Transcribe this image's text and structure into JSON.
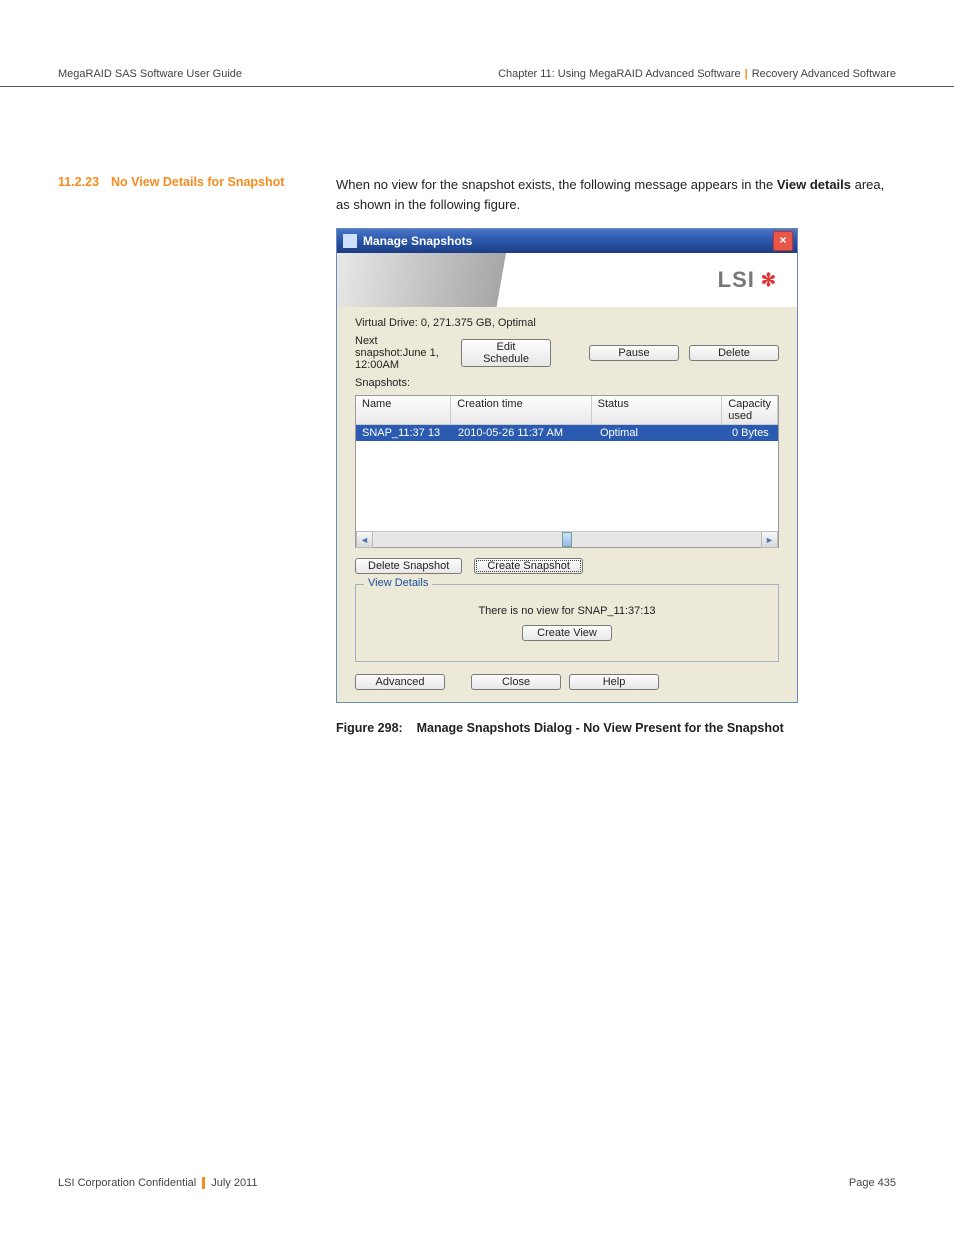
{
  "header": {
    "doc_title": "MegaRAID SAS Software User Guide",
    "chapter": "Chapter 11: Using MegaRAID Advanced Software",
    "section": "Recovery Advanced Software"
  },
  "section_heading": {
    "number": "11.2.23",
    "title": "No View Details for Snapshot"
  },
  "intro": {
    "pre": "When no view for the snapshot exists, the following message appears in the ",
    "bold1": "View details",
    "post": " area, as shown in the following figure."
  },
  "dialog": {
    "title": "Manage Snapshots",
    "logo_text": "LSI",
    "virtual_drive": "Virtual Drive: 0, 271.375 GB, Optimal",
    "next_snapshot_label": "Next snapshot:June 1, 12:00AM",
    "snapshots_label": "Snapshots:",
    "buttons": {
      "edit_schedule": "Edit Schedule",
      "pause": "Pause",
      "delete": "Delete",
      "delete_snapshot": "Delete Snapshot",
      "create_snapshot": "Create Snapshot",
      "create_view": "Create View",
      "advanced": "Advanced",
      "close": "Close",
      "help": "Help"
    },
    "columns": {
      "name": "Name",
      "creation_time": "Creation time",
      "status": "Status",
      "capacity_used": "Capacity used"
    },
    "row": {
      "name": "SNAP_11:37 13",
      "time": "2010-05-26 11:37 AM",
      "status": "Optimal",
      "capacity": "0 Bytes"
    },
    "view_details_legend": "View Details",
    "no_view_message": "There is no view for SNAP_11:37:13"
  },
  "figure_caption": {
    "label": "Figure 298:",
    "text": "Manage Snapshots Dialog - No View Present for the Snapshot"
  },
  "footer": {
    "confidential": "LSI Corporation Confidential",
    "date": "July 2011",
    "page": "Page 435"
  }
}
